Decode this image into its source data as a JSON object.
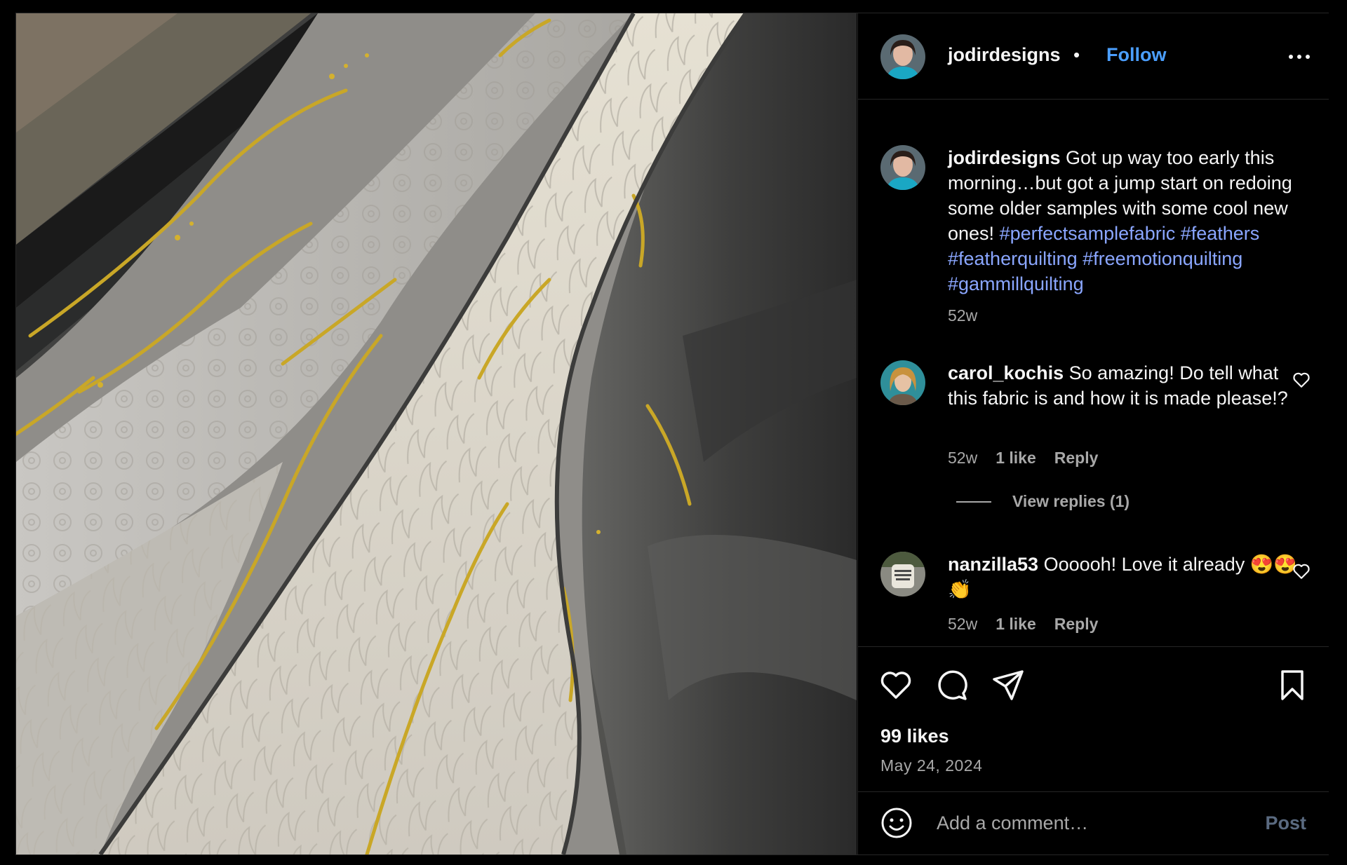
{
  "post": {
    "username": "jodirdesigns",
    "separator": "•",
    "follow_label": "Follow",
    "photo_icon": "quilted-fabric-photo"
  },
  "caption": {
    "username": "jodirdesigns",
    "text": "Got up way too early this morning…but got a jump start on redoing some older samples with some cool new ones!",
    "hashtags": [
      "#perfectsamplefabric",
      "#feathers",
      "#featherquilting",
      "#freemotionquilting",
      "#gammillquilting"
    ],
    "age": "52w"
  },
  "comments": [
    {
      "username": "carol_kochis",
      "text": "So amazing! Do tell what this fabric is and how it is made please!?",
      "age": "52w",
      "likes": "1 like",
      "reply_label": "Reply"
    },
    {
      "username": "nanzilla53",
      "text": "Oooooh! Love it already 😍😍👏",
      "age": "52w",
      "likes": "1 like",
      "reply_label": "Reply"
    }
  ],
  "view_replies_label": "View replies (1)",
  "actions": {
    "icons": [
      "heart-icon",
      "comment-icon",
      "share-icon",
      "bookmark-icon"
    ],
    "likes_count": "99 likes",
    "date": "May 24, 2024"
  },
  "add_comment": {
    "placeholder": "Add a comment…",
    "post_label": "Post",
    "emoji_icon": "smile-icon"
  },
  "colors": {
    "background": "#000000",
    "link": "#4b9fff",
    "hashtag": "#8aa6ff",
    "muted": "#a8a8a8"
  }
}
